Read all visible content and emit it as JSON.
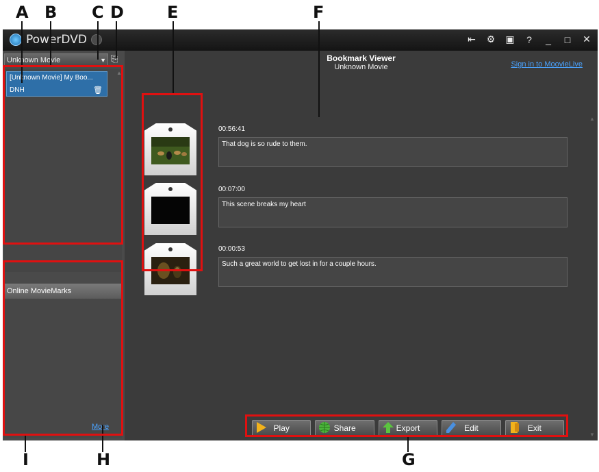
{
  "callouts": {
    "a": "A",
    "b": "B",
    "c": "C",
    "d": "D",
    "e": "E",
    "f": "F",
    "g": "G",
    "h": "H",
    "i": "I"
  },
  "app": {
    "title": "PowerDVD"
  },
  "titlebar": {
    "icons": [
      "back-icon",
      "settings-icon",
      "tv-icon",
      "help-icon",
      "minimize-icon",
      "maximize-icon",
      "close-icon"
    ]
  },
  "sidebar": {
    "movie_select": "Unknown Movie",
    "bookmark_list": [
      {
        "title": "[Unknown Movie] My Boo...",
        "sub": "DNH"
      }
    ],
    "online": {
      "header": "Online MovieMarks",
      "more_link": "More"
    }
  },
  "main": {
    "title": "Bookmark Viewer",
    "subtitle": "Unknown Movie",
    "signin_link": "Sign in to MoovieLive",
    "bookmarks": [
      {
        "time": "00:56:41",
        "note": "That dog is so rude to them."
      },
      {
        "time": "00:07:00",
        "note": "This scene breaks my heart"
      },
      {
        "time": "00:00:53",
        "note": "Such a great world to get lost in for a couple hours."
      }
    ]
  },
  "buttons": {
    "play": "Play",
    "share": "Share",
    "export": "Export",
    "edit": "Edit",
    "exit": "Exit"
  },
  "colors": {
    "highlight": "#e01010",
    "link": "#4aa3ff",
    "selected_item": "#2e6fa8"
  }
}
